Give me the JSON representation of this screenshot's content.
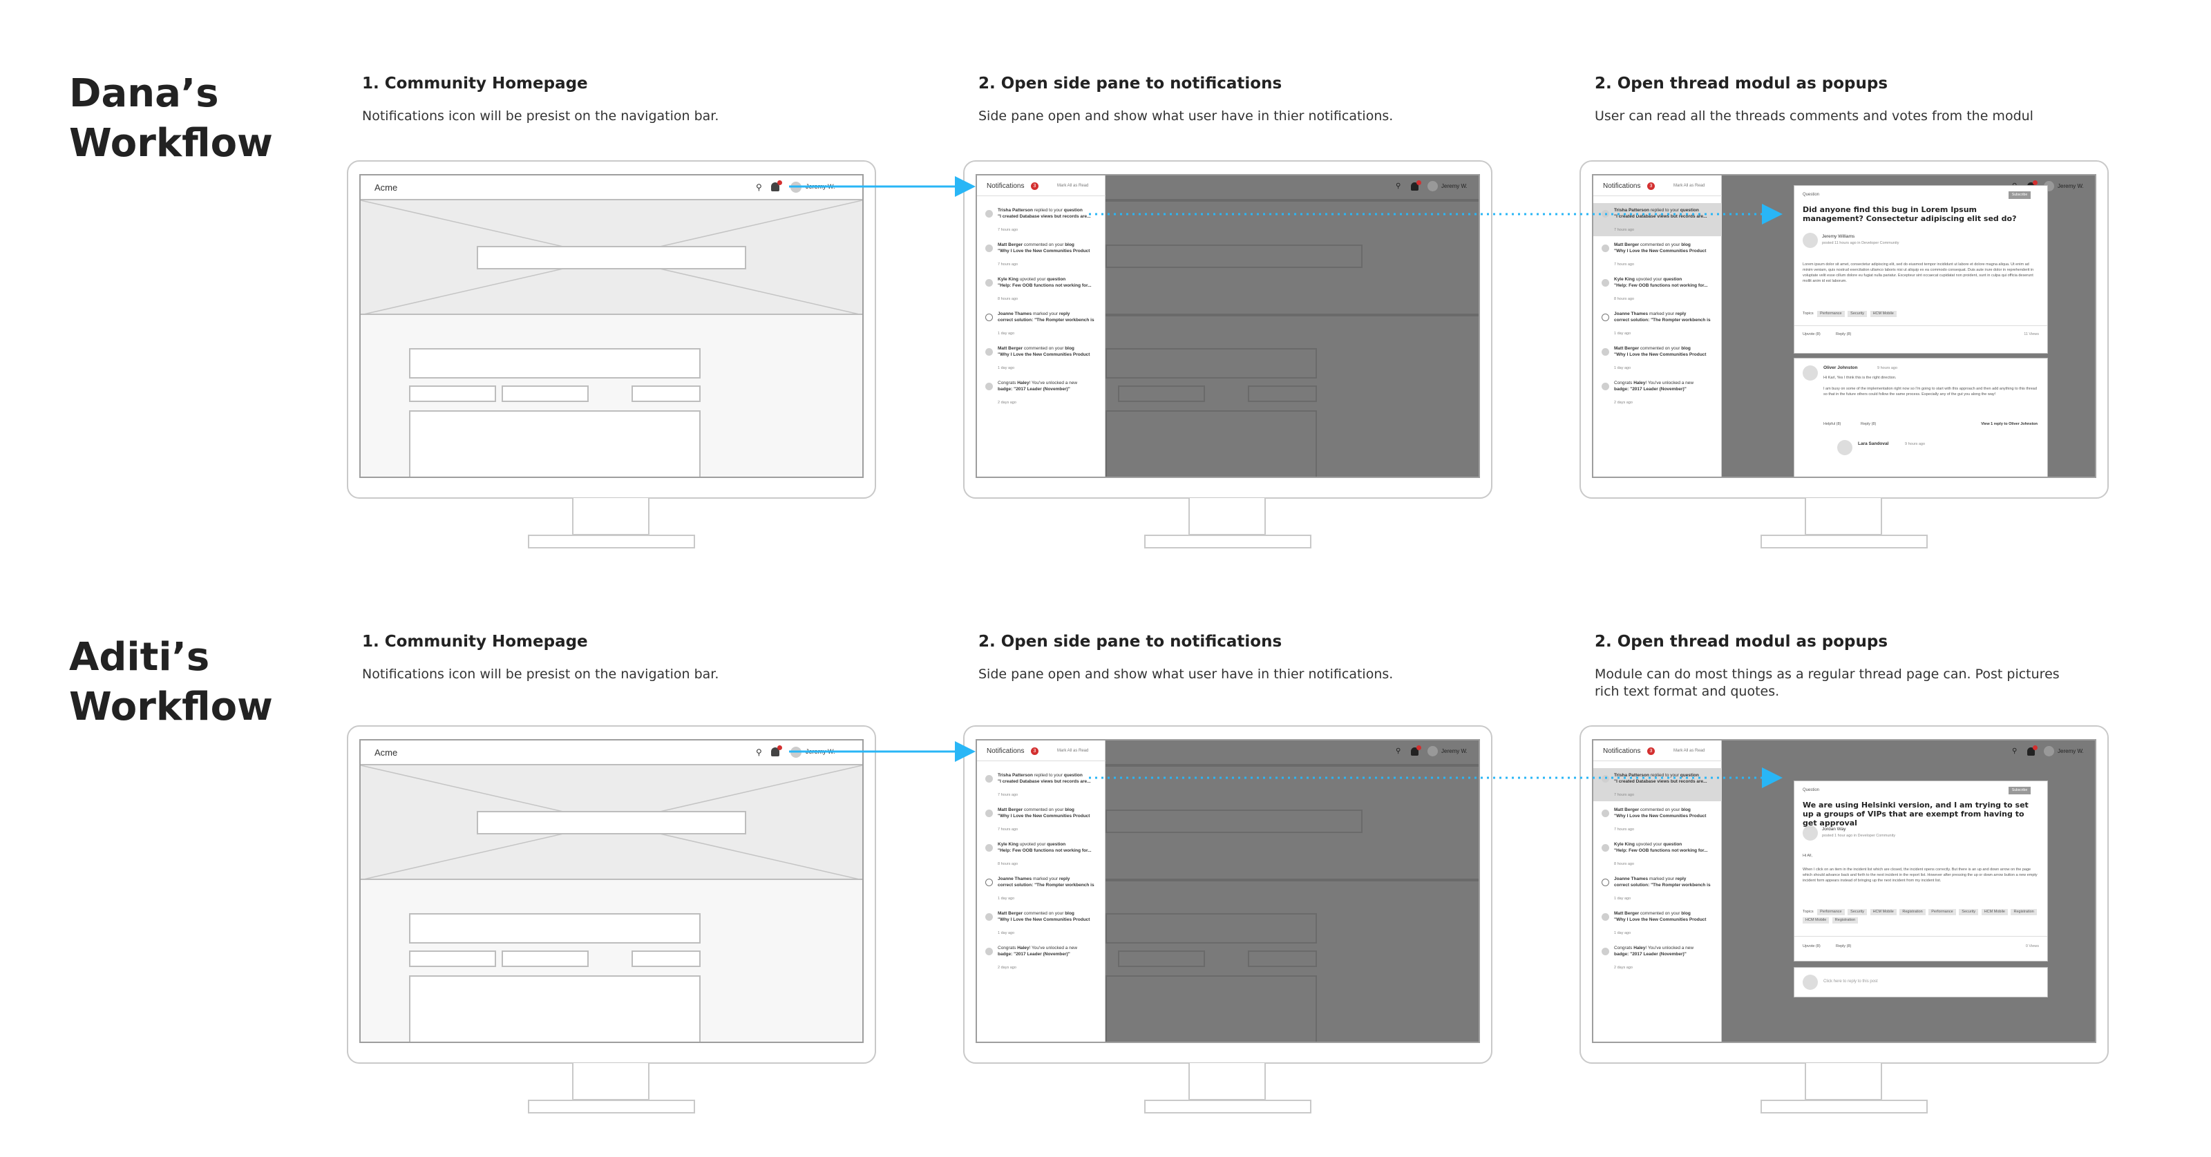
{
  "rows": [
    {
      "heading": [
        "Dana’s",
        "Workflow"
      ],
      "steps": [
        {
          "title": "1. Community Homepage",
          "desc": "Notifications icon will be presist on the navigation bar."
        },
        {
          "title": "2. Open side pane to notifications",
          "desc": "Side pane open and show what user have in thier notifications."
        },
        {
          "title": "2. Open thread modul as popups",
          "desc": "User can read all the threads comments and votes from the modul"
        }
      ],
      "modal": {
        "tag": "Question",
        "subscribe": "Subscribe",
        "title": "Did anyone find this bug in Lorem Ipsum management? Consectetur adipiscing elit sed do?",
        "author": "Jeremy Williams",
        "meta": "posted 11 hours ago in Developer Community",
        "body": "Lorem ipsum dolor sit amet, consectetur adipiscing elit, sed do eiusmod tempor incididunt ut labore et dolore magna aliqua. Ut enim ad minim veniam, quis nostrud exercitation ullamco laboris nisi ut aliquip ex ea commodo consequat. Duis aute irure dolor in reprehenderit in voluptate velit esse cillum dolore eu fugiat nulla pariatur. Excepteur sint occaecat cupidatat non proident, sunt in culpa qui officia deserunt mollit anim id est laborum.",
        "topics_label": "Topics",
        "topics": [
          "Performance",
          "Security",
          "HCM Mobile"
        ],
        "upvote": "Upvote (8)",
        "reply": "Reply (8)",
        "views": "11 Views",
        "comment": {
          "name": "Oliver Johnston",
          "time": "9 hours ago",
          "first": "Hi Karl, Yes I think this is the right direction.",
          "text": "I am busy on some of the implementation right now so I'm going to start with this approach and then add anything to this thread so that in the future others could follow the same process. Especially any of the gut you along the way!",
          "helpful": "Helpful (8)",
          "reply": "Reply (8)",
          "view_replies": "View 1 reply to Oliver Johnston",
          "sub_name": "Lara Sandoval",
          "sub_time": "9 hours ago"
        }
      }
    },
    {
      "heading": [
        "Aditi’s",
        "Workflow"
      ],
      "steps": [
        {
          "title": "1. Community Homepage",
          "desc": "Notifications icon will be presist on the navigation bar."
        },
        {
          "title": "2. Open side pane to notifications",
          "desc": "Side pane open and show what user have in thier notifications."
        },
        {
          "title": "2. Open thread modul as popups",
          "desc": "Module can do most things as a regular thread page can. Post pictures rich text format and quotes."
        }
      ],
      "modal": {
        "tag": "Question",
        "subscribe": "Subscribe",
        "title": "We are using Helsinki version, and I am trying to set up a groups of VIPs that are exempt from having to get approval",
        "author": "Jordan Way",
        "meta": "posted 1 hour ago in Developer Community",
        "greeting": "Hi All,",
        "body": "When I click on an item in the incident list which are closed, the incident opens correctly. But there is an up and down arrow on the page which should advance back and forth to the next incident in the report list. However after pressing the up or down arrow button a new empty incident form appears instead of bringing up the next incident from my incident list.",
        "topics_label": "Topics",
        "topics": [
          "Performance",
          "Security",
          "HCM Mobile",
          "Registration",
          "Performance",
          "Security",
          "HCM Mobile",
          "Registration",
          "HCM Mobile",
          "Registration"
        ],
        "upvote": "Upvote (8)",
        "reply": "Reply (8)",
        "views": "0 Views",
        "reply_placeholder": "Click here to reply to this post"
      }
    }
  ],
  "homepage": {
    "brand": "Acme",
    "search_icon": "search-icon",
    "user": "Jeremy W."
  },
  "notifications": {
    "title": "Notifications",
    "count": "3",
    "mark_all": "Mark All as Read",
    "items": [
      {
        "who": "Trisha Patterson",
        "action": " replied to your ",
        "target": "question",
        "line2": "\"I created Database views but records are...",
        "time": "7 hours ago",
        "check": false
      },
      {
        "who": "Matt Berger",
        "action": " commented on your ",
        "target": "blog",
        "line2": "\"Why I Love the New Communities Product",
        "time": "7 hours ago",
        "check": false
      },
      {
        "who": "Kyle King",
        "action": " upvoted your ",
        "target": "question",
        "line2": "\"Help: Few OOB functions not working for...",
        "time": "8 hours ago",
        "check": false
      },
      {
        "who": "Joanne Thames",
        "action": " marked your ",
        "target": "reply",
        "line2": "correct solution: \"The Rompter workbench is",
        "time": "1 day ago",
        "check": true
      },
      {
        "who": "Matt Berger",
        "action": " commented on your ",
        "target": "blog",
        "line2": "\"Why I Love the New Communities Product",
        "time": "1 day ago",
        "check": false
      },
      {
        "who": "Congrats ",
        "action": "Haley",
        "target": "! You've unlocked a new",
        "line2": "badge: \"2017 Leader (November)\"",
        "time": "2 days ago",
        "check": false
      }
    ]
  },
  "colors": {
    "arrow": "#29b6f6",
    "dim": "#7a7a7a",
    "badge": "#d32f2f"
  }
}
